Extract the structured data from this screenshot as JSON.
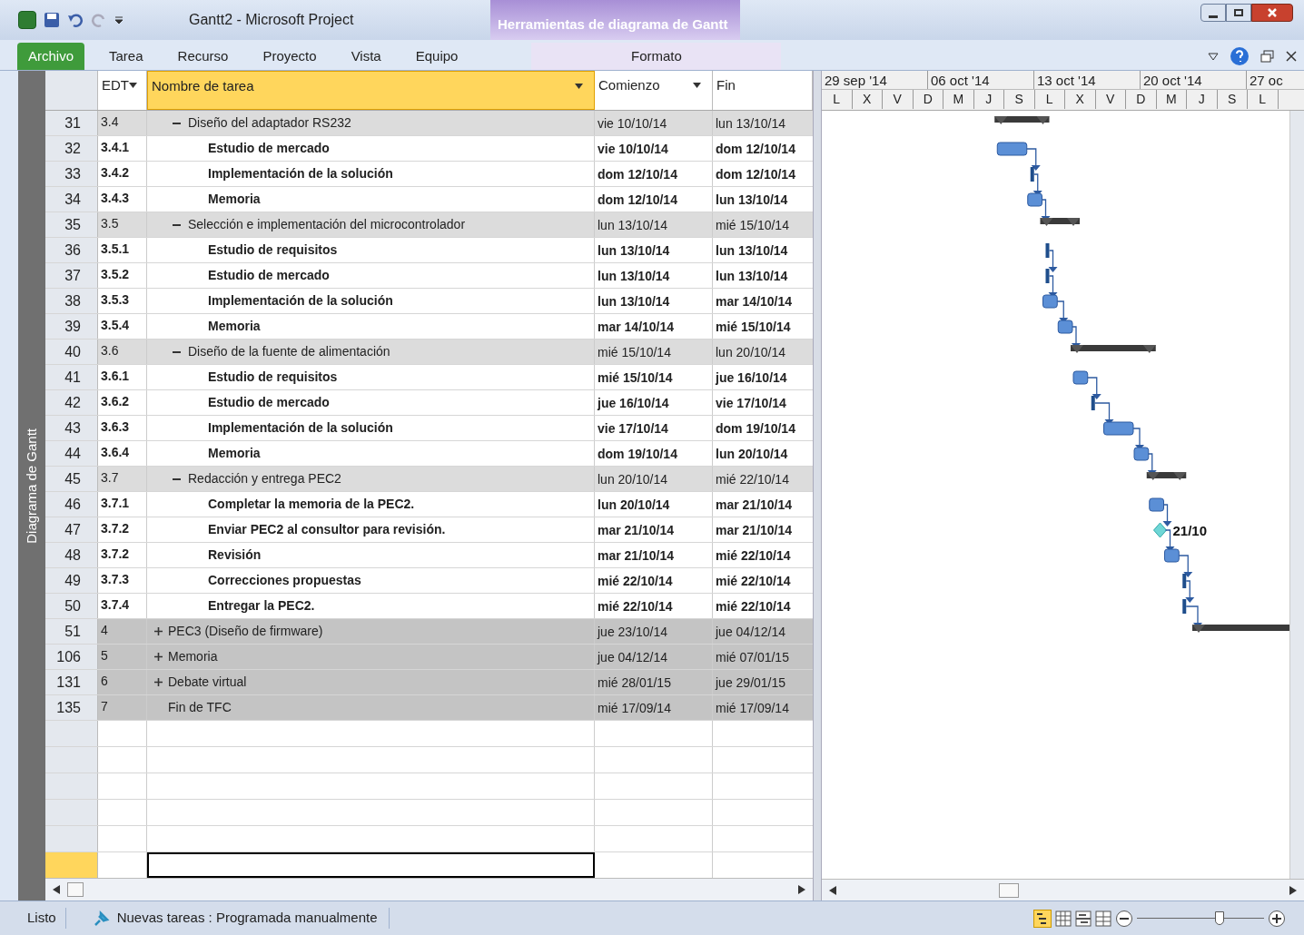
{
  "window": {
    "title": "Gantt2  -  Microsoft Project",
    "context_title": "Herramientas de diagrama de Gantt"
  },
  "ribbon": {
    "tabs": [
      {
        "label": "Archivo",
        "kind": "file"
      },
      {
        "label": "Tarea",
        "kind": "tab"
      },
      {
        "label": "Recurso",
        "kind": "tab"
      },
      {
        "label": "Proyecto",
        "kind": "tab"
      },
      {
        "label": "Vista",
        "kind": "tab"
      },
      {
        "label": "Equipo",
        "kind": "tab"
      },
      {
        "label": "Formato",
        "kind": "context"
      }
    ]
  },
  "view_bar": {
    "label": "Diagrama de Gantt"
  },
  "table": {
    "columns": [
      {
        "label": "EDT",
        "selected": false,
        "filter": true
      },
      {
        "label": "Nombre de tarea",
        "selected": true,
        "filter": true
      },
      {
        "label": "Comienzo",
        "selected": false,
        "filter": true
      },
      {
        "label": "Fin",
        "selected": false,
        "filter": false
      }
    ],
    "rows": [
      {
        "id": "31",
        "wbs": "3.4",
        "name": "Diseño del adaptador RS232",
        "start": "vie 10/10/14",
        "finish": "lun 13/10/14",
        "kind": "group",
        "bar": {
          "kind": "summary"
        }
      },
      {
        "id": "32",
        "wbs": "3.4.1",
        "name": "Estudio de mercado",
        "start": "vie 10/10/14",
        "finish": "dom 12/10/14",
        "kind": "task",
        "bar": {
          "kind": "task"
        }
      },
      {
        "id": "33",
        "wbs": "3.4.2",
        "name": "Implementación de la solución",
        "start": "dom 12/10/14",
        "finish": "dom 12/10/14",
        "kind": "task",
        "bar": {
          "kind": "thin"
        }
      },
      {
        "id": "34",
        "wbs": "3.4.3",
        "name": "Memoria",
        "start": "dom 12/10/14",
        "finish": "lun 13/10/14",
        "kind": "task",
        "bar": {
          "kind": "task"
        }
      },
      {
        "id": "35",
        "wbs": "3.5",
        "name": "Selección e implementación del microcontrolador",
        "start": "lun 13/10/14",
        "finish": "mié 15/10/14",
        "kind": "group",
        "bar": {
          "kind": "summary"
        }
      },
      {
        "id": "36",
        "wbs": "3.5.1",
        "name": "Estudio de requisitos",
        "start": "lun 13/10/14",
        "finish": "lun 13/10/14",
        "kind": "task",
        "bar": {
          "kind": "thin"
        }
      },
      {
        "id": "37",
        "wbs": "3.5.2",
        "name": "Estudio de mercado",
        "start": "lun 13/10/14",
        "finish": "lun 13/10/14",
        "kind": "task",
        "bar": {
          "kind": "thin"
        }
      },
      {
        "id": "38",
        "wbs": "3.5.3",
        "name": "Implementación de la solución",
        "start": "lun 13/10/14",
        "finish": "mar 14/10/14",
        "kind": "task",
        "bar": {
          "kind": "task"
        }
      },
      {
        "id": "39",
        "wbs": "3.5.4",
        "name": "Memoria",
        "start": "mar 14/10/14",
        "finish": "mié 15/10/14",
        "kind": "task",
        "bar": {
          "kind": "task"
        }
      },
      {
        "id": "40",
        "wbs": "3.6",
        "name": "Diseño de la fuente de alimentación",
        "start": "mié 15/10/14",
        "finish": "lun 20/10/14",
        "kind": "group",
        "bar": {
          "kind": "summary"
        }
      },
      {
        "id": "41",
        "wbs": "3.6.1",
        "name": "Estudio de requisitos",
        "start": "mié 15/10/14",
        "finish": "jue 16/10/14",
        "kind": "task",
        "bar": {
          "kind": "task"
        }
      },
      {
        "id": "42",
        "wbs": "3.6.2",
        "name": "Estudio de mercado",
        "start": "jue 16/10/14",
        "finish": "vie 17/10/14",
        "kind": "task",
        "bar": {
          "kind": "thin"
        }
      },
      {
        "id": "43",
        "wbs": "3.6.3",
        "name": "Implementación de la solución",
        "start": "vie 17/10/14",
        "finish": "dom 19/10/14",
        "kind": "task",
        "bar": {
          "kind": "task"
        }
      },
      {
        "id": "44",
        "wbs": "3.6.4",
        "name": "Memoria",
        "start": "dom 19/10/14",
        "finish": "lun 20/10/14",
        "kind": "task",
        "bar": {
          "kind": "task"
        }
      },
      {
        "id": "45",
        "wbs": "3.7",
        "name": "Redacción y entrega PEC2",
        "start": "lun 20/10/14",
        "finish": "mié 22/10/14",
        "kind": "group",
        "bar": {
          "kind": "summary"
        }
      },
      {
        "id": "46",
        "wbs": "3.7.1",
        "name": "Completar la memoria de la PEC2.",
        "start": "lun 20/10/14",
        "finish": "mar 21/10/14",
        "kind": "task",
        "bar": {
          "kind": "task"
        }
      },
      {
        "id": "47",
        "wbs": "3.7.2",
        "name": "Enviar PEC2 al consultor para revisión.",
        "start": "mar 21/10/14",
        "finish": "mar 21/10/14",
        "kind": "task",
        "bar": {
          "kind": "milestone",
          "label": "21/10"
        }
      },
      {
        "id": "48",
        "wbs": "3.7.2",
        "name": "Revisión",
        "start": "mar 21/10/14",
        "finish": "mié 22/10/14",
        "kind": "task",
        "bar": {
          "kind": "task"
        }
      },
      {
        "id": "49",
        "wbs": "3.7.3",
        "name": "Correcciones propuestas",
        "start": "mié 22/10/14",
        "finish": "mié 22/10/14",
        "kind": "task",
        "bar": {
          "kind": "thin"
        }
      },
      {
        "id": "50",
        "wbs": "3.7.4",
        "name": "Entregar la PEC2.",
        "start": "mié 22/10/14",
        "finish": "mié 22/10/14",
        "kind": "task",
        "bar": {
          "kind": "thin"
        }
      },
      {
        "id": "51",
        "wbs": "4",
        "name": "PEC3 (Diseño de firmware)",
        "start": "jue 23/10/14",
        "finish": "jue 04/12/14",
        "kind": "collapsed",
        "bar": {
          "kind": "summary"
        }
      },
      {
        "id": "106",
        "wbs": "5",
        "name": "Memoria",
        "start": "jue 04/12/14",
        "finish": "mié 07/01/15",
        "kind": "collapsed"
      },
      {
        "id": "131",
        "wbs": "6",
        "name": "Debate virtual",
        "start": "mié 28/01/15",
        "finish": "jue 29/01/15",
        "kind": "collapsed"
      },
      {
        "id": "135",
        "wbs": "7",
        "name": "Fin de TFC",
        "start": "mié 17/09/14",
        "finish": "mié 17/09/14",
        "kind": "top"
      }
    ]
  },
  "timescale": {
    "weeks": [
      "29 sep '14",
      "06 oct '14",
      "13 oct '14",
      "20 oct '14",
      "27 oc"
    ],
    "days": [
      "L",
      "X",
      "V",
      "D",
      "M",
      "J",
      "S",
      "L",
      "X",
      "V",
      "D",
      "M",
      "J",
      "S",
      "L"
    ]
  },
  "status_bar": {
    "mode": "Listo",
    "new_tasks": "Nuevas tareas : Programada manualmente",
    "zoom": {
      "level": 0.65
    }
  }
}
